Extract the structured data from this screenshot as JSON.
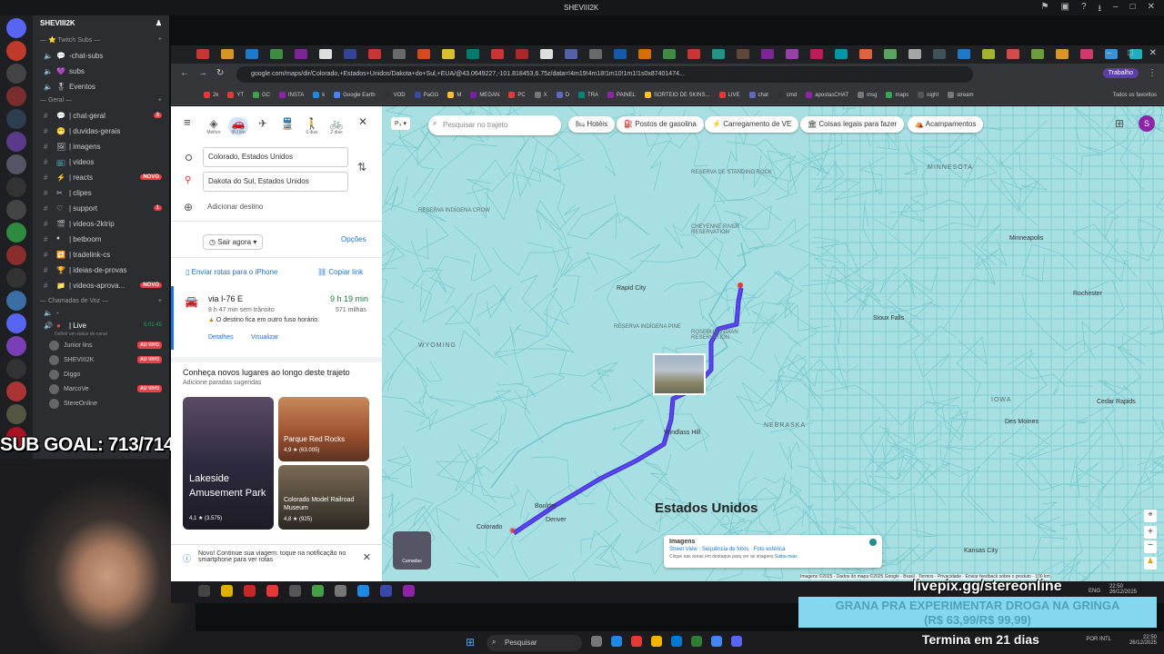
{
  "discord": {
    "window_title": "SHEVIII2K",
    "server_name": "SHEVIII2K",
    "categories": {
      "subs": "Twitch Subs",
      "geral": "Geral",
      "voice": "Chamadas de Voz"
    },
    "sub_channels": [
      {
        "icon": "💬",
        "label": "-chat-subs"
      },
      {
        "icon": "💜",
        "label": "subs"
      },
      {
        "icon": "🎖",
        "label": "Eventos"
      }
    ],
    "channels": [
      {
        "icon": "💬",
        "label": "| chat-geral",
        "badge": "3"
      },
      {
        "icon": "😁",
        "label": "| duvidas-gerais"
      },
      {
        "icon": "🖼",
        "label": "| imagens"
      },
      {
        "icon": "📺",
        "label": "| videos"
      },
      {
        "icon": "⚡",
        "label": "| reacts",
        "badge": "NOVO"
      },
      {
        "icon": "✂",
        "label": "| clipes"
      },
      {
        "icon": "♡",
        "label": "| support",
        "badge": "1"
      },
      {
        "icon": "🎬",
        "label": "| videos-2ktrip"
      },
      {
        "icon": "ꔷ",
        "label": "| betboom"
      },
      {
        "icon": "🔁",
        "label": "| tradelink-cs"
      },
      {
        "icon": "🏆",
        "label": "| ideias-de-provas"
      },
      {
        "icon": "📁",
        "label": "| videos-aprova...",
        "badge": "NOVO"
      }
    ],
    "voice_channel": {
      "label": "| Live",
      "time": "5:01:45",
      "status": "Definir um status do canal"
    },
    "voice_users": [
      {
        "name": "Junior lins",
        "live": "AO VIVO"
      },
      {
        "name": "SHEVIII2K",
        "live": "AO VIVO"
      },
      {
        "name": "Diggo",
        "live": ""
      },
      {
        "name": "MarcoVe",
        "live": "AO VIVO"
      },
      {
        "name": "StereOnline",
        "live": ""
      }
    ]
  },
  "overlay": {
    "sub_goal": "SUB GOAL: 713/714",
    "livepix": "livepix.gg/stereonline",
    "banner_line1": "GRANA PRA EXPERIMENTAR DROGA NA GRINGA",
    "banner_line2": "(R$ 63,99/R$ 99,99)",
    "countdown": "Termina em 21 dias"
  },
  "browser": {
    "url": "google.com/maps/dir/Colorado,+Estados+Unidos/Dakota+do+Sul,+EUA/@43.0649227,-101.818453,6.75z/data=!4m19!4m18!1m10!1m1!1s0x87401474...",
    "profile": "Trabalho",
    "bookmarks": [
      "2k",
      "YT",
      "GC",
      "INSTA",
      "k",
      "Google Earth",
      "VOD",
      "PaGG",
      "M",
      "MEGAN",
      "PC",
      "X",
      "D",
      "TRA",
      "PAINEL",
      "SORTEIO DE SKINS...",
      "LIVE",
      "chat",
      "cmd",
      "apostasCHAT",
      "msg",
      "maps",
      "night",
      "stream"
    ],
    "bookmarks_all": "Todos os favoritos"
  },
  "maps": {
    "modes": [
      {
        "icon": "◈",
        "label": "Melhor"
      },
      {
        "icon": "🚗",
        "label": "9h19m"
      },
      {
        "icon": "✈",
        "label": ""
      },
      {
        "icon": "🚆",
        "label": ""
      },
      {
        "icon": "🚶",
        "label": "6 dias"
      },
      {
        "icon": "🚲",
        "label": "2 dias"
      }
    ],
    "origin": "Colorado, Estados Unidos",
    "destination": "Dakota do Sul, Estados Unidos",
    "add_destination": "Adicionar destino",
    "depart": "Sair agora",
    "options": "Opções",
    "send_phone": "Enviar rotas para o iPhone",
    "copy_link": "Copiar link",
    "route": {
      "via": "via I-76 E",
      "time": "9 h 19 min",
      "traffic": "8 h 47 min sem trânsito",
      "distance": "571 milhas",
      "warning": "O destino fica em outro fuso horário.",
      "details": "Detalhes",
      "view": "Visualizar"
    },
    "discover_title": "Conheça novos lugares ao longo deste trajeto",
    "discover_sub": "Adicione paradas sugeridas",
    "places": [
      {
        "name": "Lakeside Amusement Park",
        "rating": "4,1 ★ (3.575)"
      },
      {
        "name": "Parque Red Rocks",
        "rating": "4,9 ★ (63.005)"
      },
      {
        "name": "Colorado Model Railroad Museum",
        "rating": "4,8 ★ (925)"
      }
    ],
    "notice": "Novo! Continue sua viagem: toque na notificação no smartphone para ver rotas",
    "search_placeholder": "Pesquisar no trajeto",
    "chips": [
      "Hotéis",
      "Postos de gasolina",
      "Carregamento de VE",
      "Coisas legais para fazer",
      "Acampamentos"
    ],
    "country_label": "Estados Unidos",
    "states": [
      "WYOMING",
      "NEBRASKA",
      "MINNESOTA",
      "IOWA"
    ],
    "cities": [
      "Minneapolis",
      "Rapid City",
      "Sioux Falls",
      "Denver",
      "Boulder",
      "Colorado",
      "Kansas City",
      "Rochester",
      "Cedar Rapids",
      "Des Moines",
      "Windlass Hill"
    ],
    "reserves": [
      "CHEYENNE RIVER RESERVATION",
      "RESERVA DE STANDING ROCK",
      "RESERVA INDÍGENA CROW",
      "ROSEBUD INDIAN RESERVATION",
      "RESERVA INDÍGENA PINE"
    ],
    "imagery": {
      "title": "Imagens",
      "street_view": "Street View",
      "photo_sequence": "Sequência de fotos",
      "sphere": "Foto esférica",
      "hint": "Clique nas áreas em destaque para ver as imagens",
      "learn": "Saiba mais"
    },
    "layers": "Camadas",
    "footer": "Imagens ©2025 · Dados do mapa ©2025 Google · Brasil · Termos · Privacidade · Enviar feedback sobre o produto · 100 km"
  },
  "taskbar": {
    "search": "Pesquisar",
    "lang": "POR INTL",
    "time": "22:50",
    "date": "26/12/2025",
    "time2": "22:50",
    "date2": "26/12/2025",
    "lang2": "ENG"
  }
}
